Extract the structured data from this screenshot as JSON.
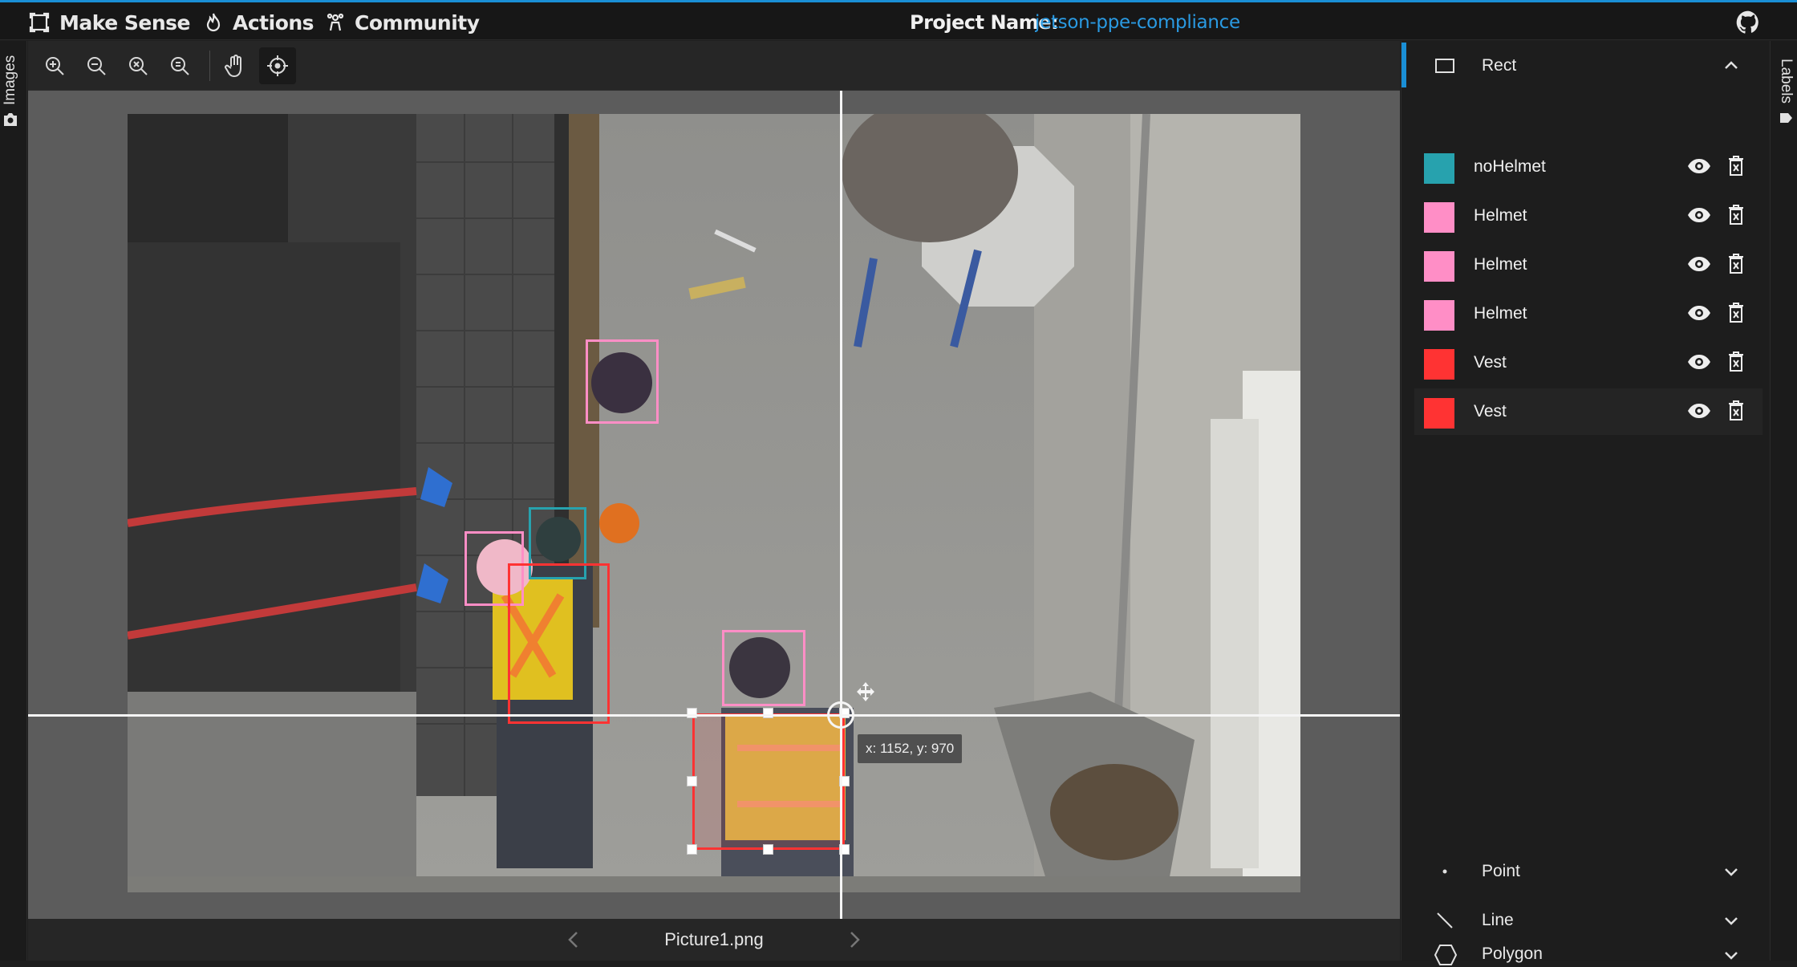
{
  "nav": {
    "brand": "Make Sense",
    "actions": "Actions",
    "community": "Community",
    "project_label": "Project Name:",
    "project_value": "jetson-ppe-compliance"
  },
  "left_tab": {
    "label": "Images",
    "icon": "camera-icon"
  },
  "right_tab": {
    "label": "Labels",
    "icon": "tag-icon"
  },
  "toolbar": {
    "tools": [
      {
        "name": "zoom-in",
        "icon": "zoom-in-icon"
      },
      {
        "name": "zoom-out",
        "icon": "zoom-out-icon"
      },
      {
        "name": "zoom-fit",
        "icon": "zoom-fit-icon"
      },
      {
        "name": "zoom-max",
        "icon": "zoom-max-icon"
      },
      {
        "name": "pan",
        "icon": "hand-icon"
      },
      {
        "name": "crosshair",
        "icon": "crosshair-icon",
        "active": true
      }
    ]
  },
  "canvas": {
    "cursor_readout": "x: 1152, y: 970",
    "filename": "Picture1.png"
  },
  "sections": {
    "rect": "Rect",
    "point": "Point",
    "line": "Line",
    "polygon": "Polygon"
  },
  "labels": [
    {
      "name": "noHelmet",
      "color": "#27a2ae"
    },
    {
      "name": "Helmet",
      "color": "#ff8ec6"
    },
    {
      "name": "Helmet",
      "color": "#ff8ec6"
    },
    {
      "name": "Helmet",
      "color": "#ff8ec6"
    },
    {
      "name": "Vest",
      "color": "#ff3333"
    },
    {
      "name": "Vest",
      "color": "#ff3333"
    }
  ],
  "colors": {
    "accent": "#1a8fd6",
    "helmet_box": "#ff8ec6",
    "nohelmet_box": "#27a2ae",
    "vest_box": "#ff3333"
  }
}
